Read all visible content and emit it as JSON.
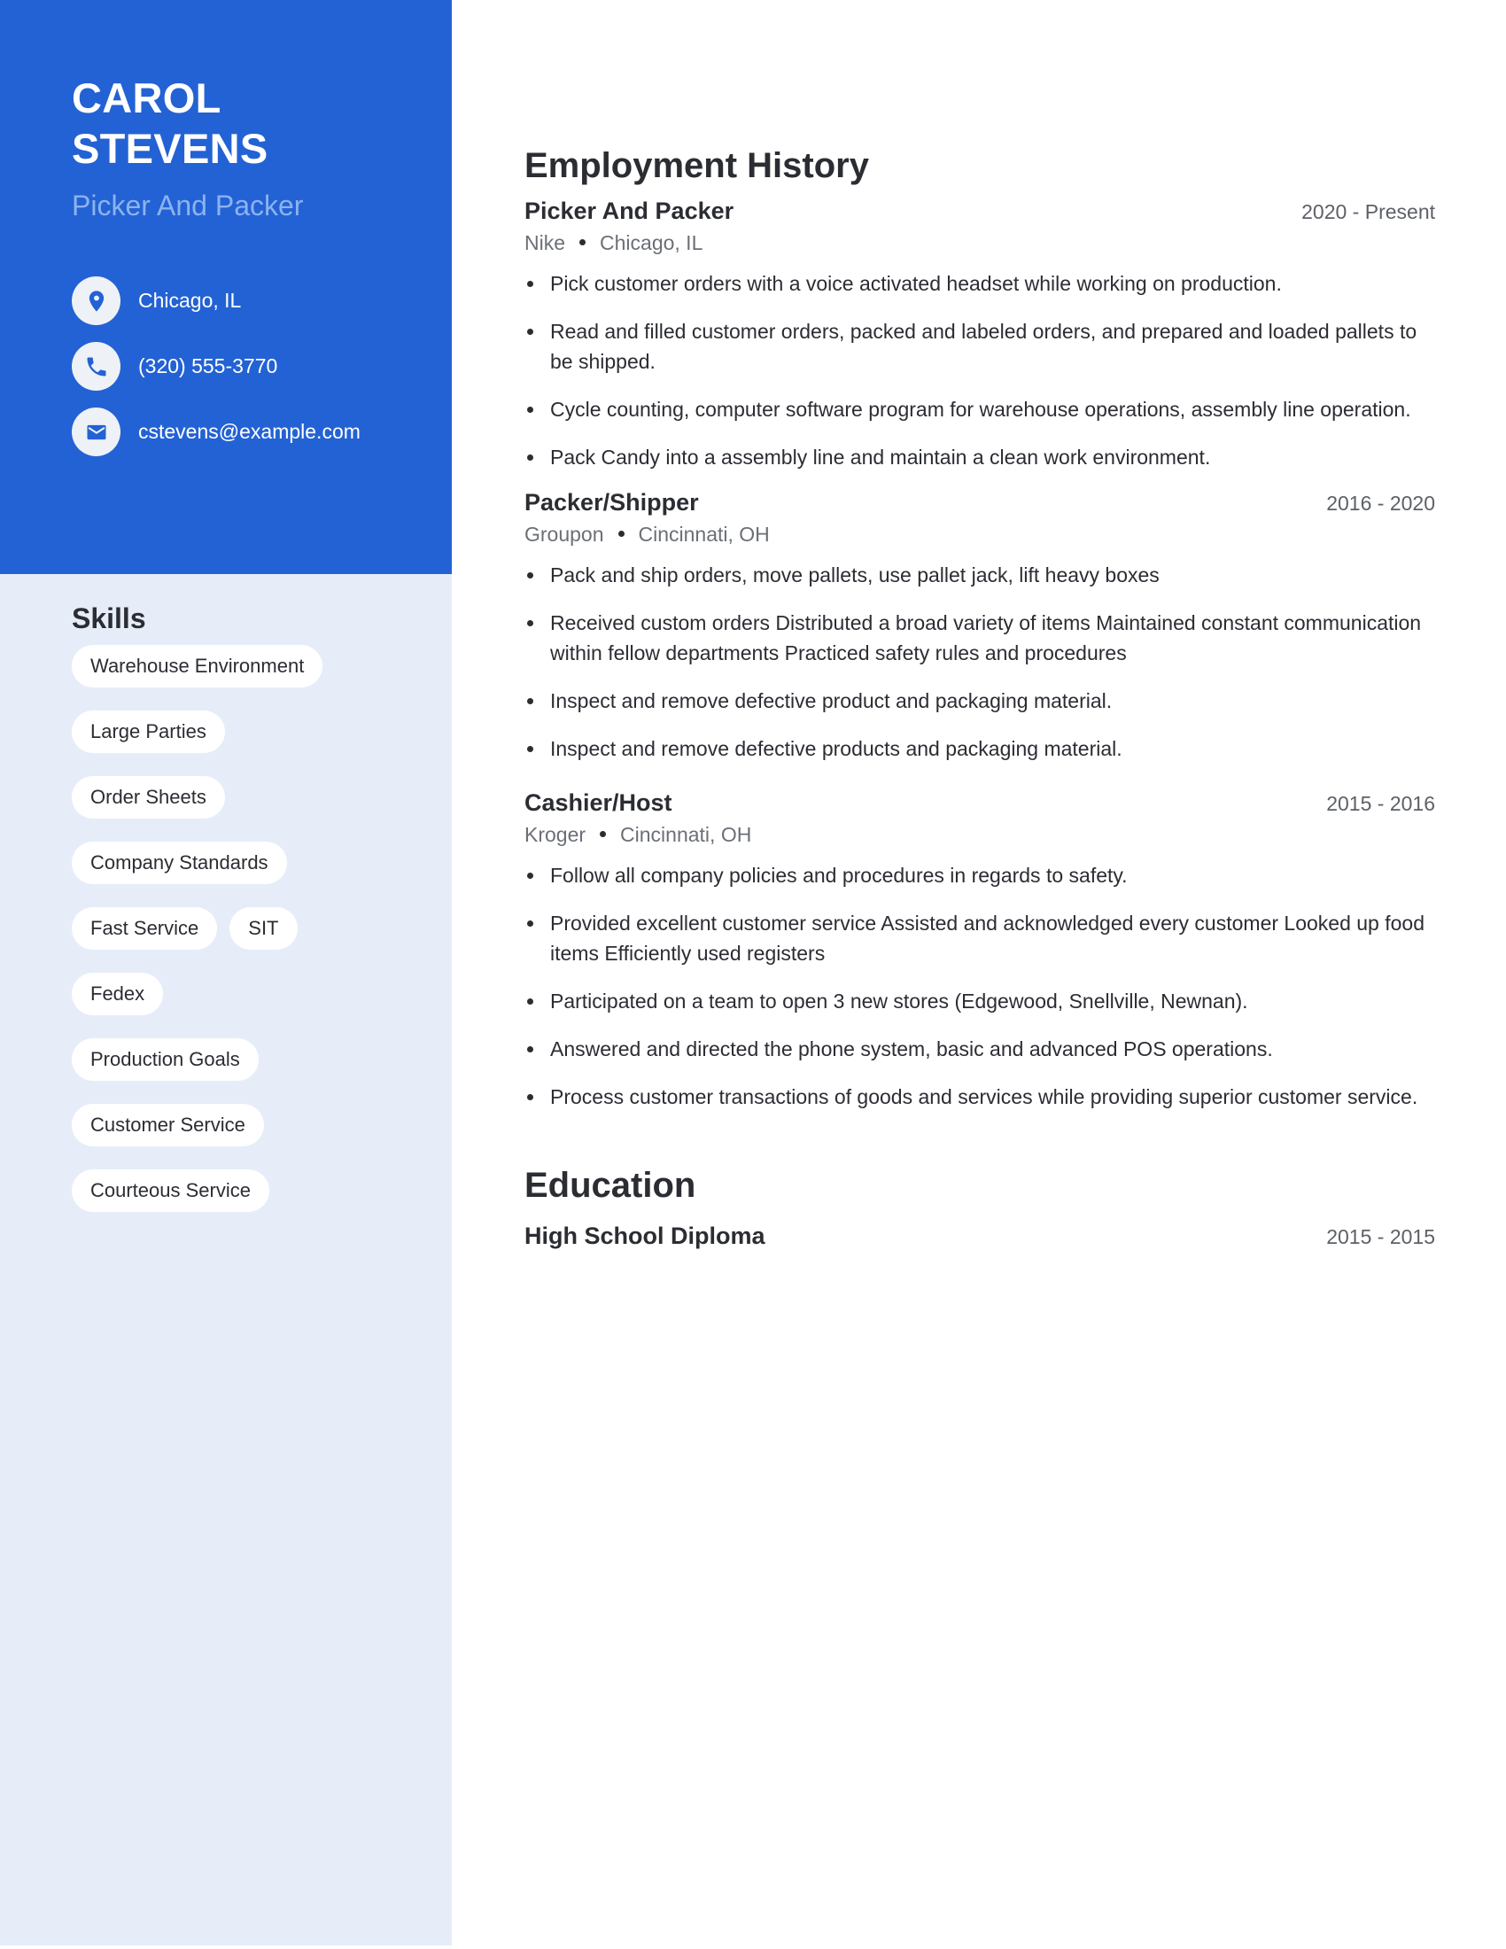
{
  "profile": {
    "first_name": "CAROL",
    "last_name": "STEVENS",
    "job_title": "Picker And Packer",
    "contacts": [
      {
        "icon": "location-pin-icon",
        "text": "Chicago, IL"
      },
      {
        "icon": "phone-icon",
        "text": "(320) 555-3770"
      },
      {
        "icon": "envelope-icon",
        "text": "cstevens@example.com"
      }
    ]
  },
  "skills": {
    "title": "Skills",
    "items": [
      "Warehouse Environment",
      "Large Parties",
      "Order Sheets",
      "Company Standards",
      "Fast Service",
      "SIT",
      "Fedex",
      "Production Goals",
      "Customer Service",
      "Courteous Service"
    ]
  },
  "employment": {
    "title": "Employment History",
    "jobs": [
      {
        "role": "Picker And Packer",
        "dates": "2020 - Present",
        "company": "Nike",
        "location": "Chicago, IL",
        "bullets": [
          "Pick customer orders with a voice activated headset while working on production.",
          "Read and filled customer orders, packed and labeled orders, and prepared and loaded pallets to be shipped.",
          "Cycle counting, computer software program for warehouse operations, assembly line operation.",
          "Pack Candy into a assembly line and maintain a clean work environment."
        ]
      },
      {
        "role": "Packer/Shipper",
        "dates": "2016 - 2020",
        "company": "Groupon",
        "location": "Cincinnati, OH",
        "bullets": [
          "Pack and ship orders, move pallets, use pallet jack, lift heavy boxes",
          "Received custom orders Distributed a broad variety of items Maintained constant communication within fellow departments Practiced safety rules and procedures",
          "Inspect and remove defective product and packaging material.",
          "Inspect and remove defective products and packaging material."
        ]
      },
      {
        "role": "Cashier/Host",
        "dates": "2015 - 2016",
        "company": "Kroger",
        "location": "Cincinnati, OH",
        "bullets": [
          "Follow all company policies and procedures in regards to safety.",
          "Provided excellent customer service Assisted and acknowledged every customer Looked up food items Efficiently used registers",
          "Participated on a team to open 3 new stores (Edgewood, Snellville, Newnan).",
          "Answered and directed the phone system, basic and advanced POS operations.",
          "Process customer transactions of goods and services while providing superior customer service."
        ]
      }
    ]
  },
  "education": {
    "title": "Education",
    "items": [
      {
        "degree": "High School Diploma",
        "dates": "2015 - 2015"
      }
    ]
  },
  "colors": {
    "accent": "#2362d4",
    "sidebar_bg": "#e6edf9",
    "subtitle": "#8cb2f0",
    "text": "#2b2d33",
    "muted": "#6c6f77"
  }
}
